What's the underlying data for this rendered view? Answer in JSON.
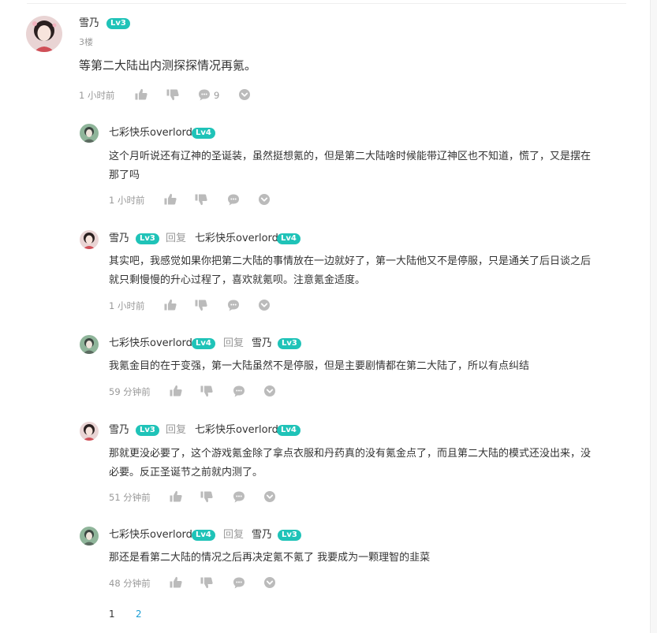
{
  "comment": {
    "username": "雪乃",
    "level": "Lv3",
    "floor": "3楼",
    "text": "等第二大陆出内测探探情况再氪。",
    "time": "1 小时前",
    "reply_count": "9"
  },
  "replies": [
    {
      "username": "七彩快乐overlord",
      "level": "Lv4",
      "text_lines": [
        "这个月听说还有辽神的圣诞装，虽然挺想氪的，但是第二大陆啥时候能带辽神区也不知道，慌了，又是摆在",
        "那了吗"
      ],
      "time": "1 小时前"
    },
    {
      "username": "雪乃",
      "level": "Lv3",
      "reply_word": "回复",
      "target": "七彩快乐overlord",
      "target_level": "Lv4",
      "text_lines": [
        "其实吧，我感觉如果你把第二大陆的事情放在一边就好了，第一大陆他又不是停服，只是通关了后日谈之后",
        "就只剩慢慢的升心过程了，喜欢就氪呗。注意氪金适度。"
      ],
      "time": "1 小时前"
    },
    {
      "username": "七彩快乐overlord",
      "level": "Lv4",
      "reply_word": "回复",
      "target": "雪乃",
      "target_level": "Lv3",
      "text_lines": [
        "我氪金目的在于变强，第一大陆虽然不是停服，但是主要剧情都在第二大陆了，所以有点纠结"
      ],
      "time": "59 分钟前"
    },
    {
      "username": "雪乃",
      "level": "Lv3",
      "reply_word": "回复",
      "target": "七彩快乐overlord",
      "target_level": "Lv4",
      "text_lines": [
        "那就更没必要了，这个游戏氪金除了拿点衣服和丹药真的没有氪金点了，而且第二大陆的模式还没出来，没",
        "必要。反正圣诞节之前就内测了。"
      ],
      "time": "51 分钟前"
    },
    {
      "username": "七彩快乐overlord",
      "level": "Lv4",
      "reply_word": "回复",
      "target": "雪乃",
      "target_level": "Lv3",
      "text_lines": [
        "那还是看第二大陆的情况之后再决定氪不氪了 我要成为一颗理智的韭菜"
      ],
      "time": "48 分钟前"
    }
  ],
  "pagination": {
    "current": "1",
    "next": "2"
  },
  "colors": {
    "badge": "#1fc3b8",
    "link": "#1a9ed5",
    "muted": "#999999",
    "icon": "#bbbbbb"
  },
  "icons": [
    "thumbs-up-icon",
    "thumbs-down-icon",
    "comment-bubble-icon",
    "chevron-down-circle-icon"
  ]
}
